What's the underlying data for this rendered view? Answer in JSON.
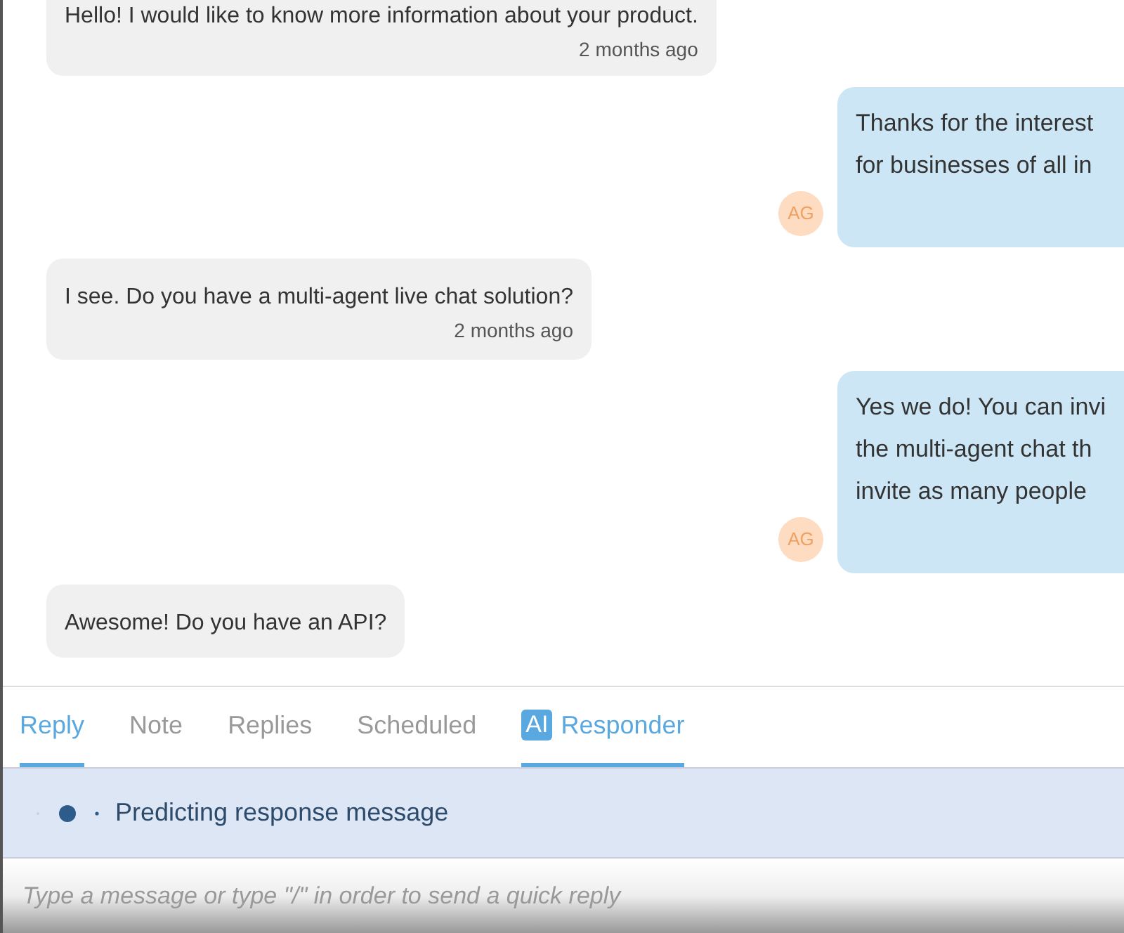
{
  "messages": [
    {
      "kind": "incoming",
      "text": "Hello! I would like to know more information about your product.",
      "time": "2 months ago"
    },
    {
      "kind": "outgoing",
      "lines": [
        "Thanks for the interest",
        "for businesses of all in"
      ],
      "avatar": "AG"
    },
    {
      "kind": "incoming",
      "text": "I see. Do you have a multi-agent live chat solution?",
      "time": "2 months ago"
    },
    {
      "kind": "outgoing",
      "lines": [
        "Yes we do! You can invi",
        "the multi-agent chat th",
        "invite as many people"
      ],
      "avatar": "AG"
    },
    {
      "kind": "incoming",
      "text": "Awesome! Do you have an API?"
    }
  ],
  "tabs": [
    {
      "label": "Reply",
      "selected": true
    },
    {
      "label": "Note",
      "selected": false
    },
    {
      "label": "Replies",
      "selected": false
    },
    {
      "label": "Scheduled",
      "selected": false
    },
    {
      "badge": "AI",
      "label": "Responder",
      "selected": true
    }
  ],
  "status": {
    "text": "Predicting response message"
  },
  "composer": {
    "placeholder": "Type a message or type \"/\" in order to send a quick reply"
  }
}
